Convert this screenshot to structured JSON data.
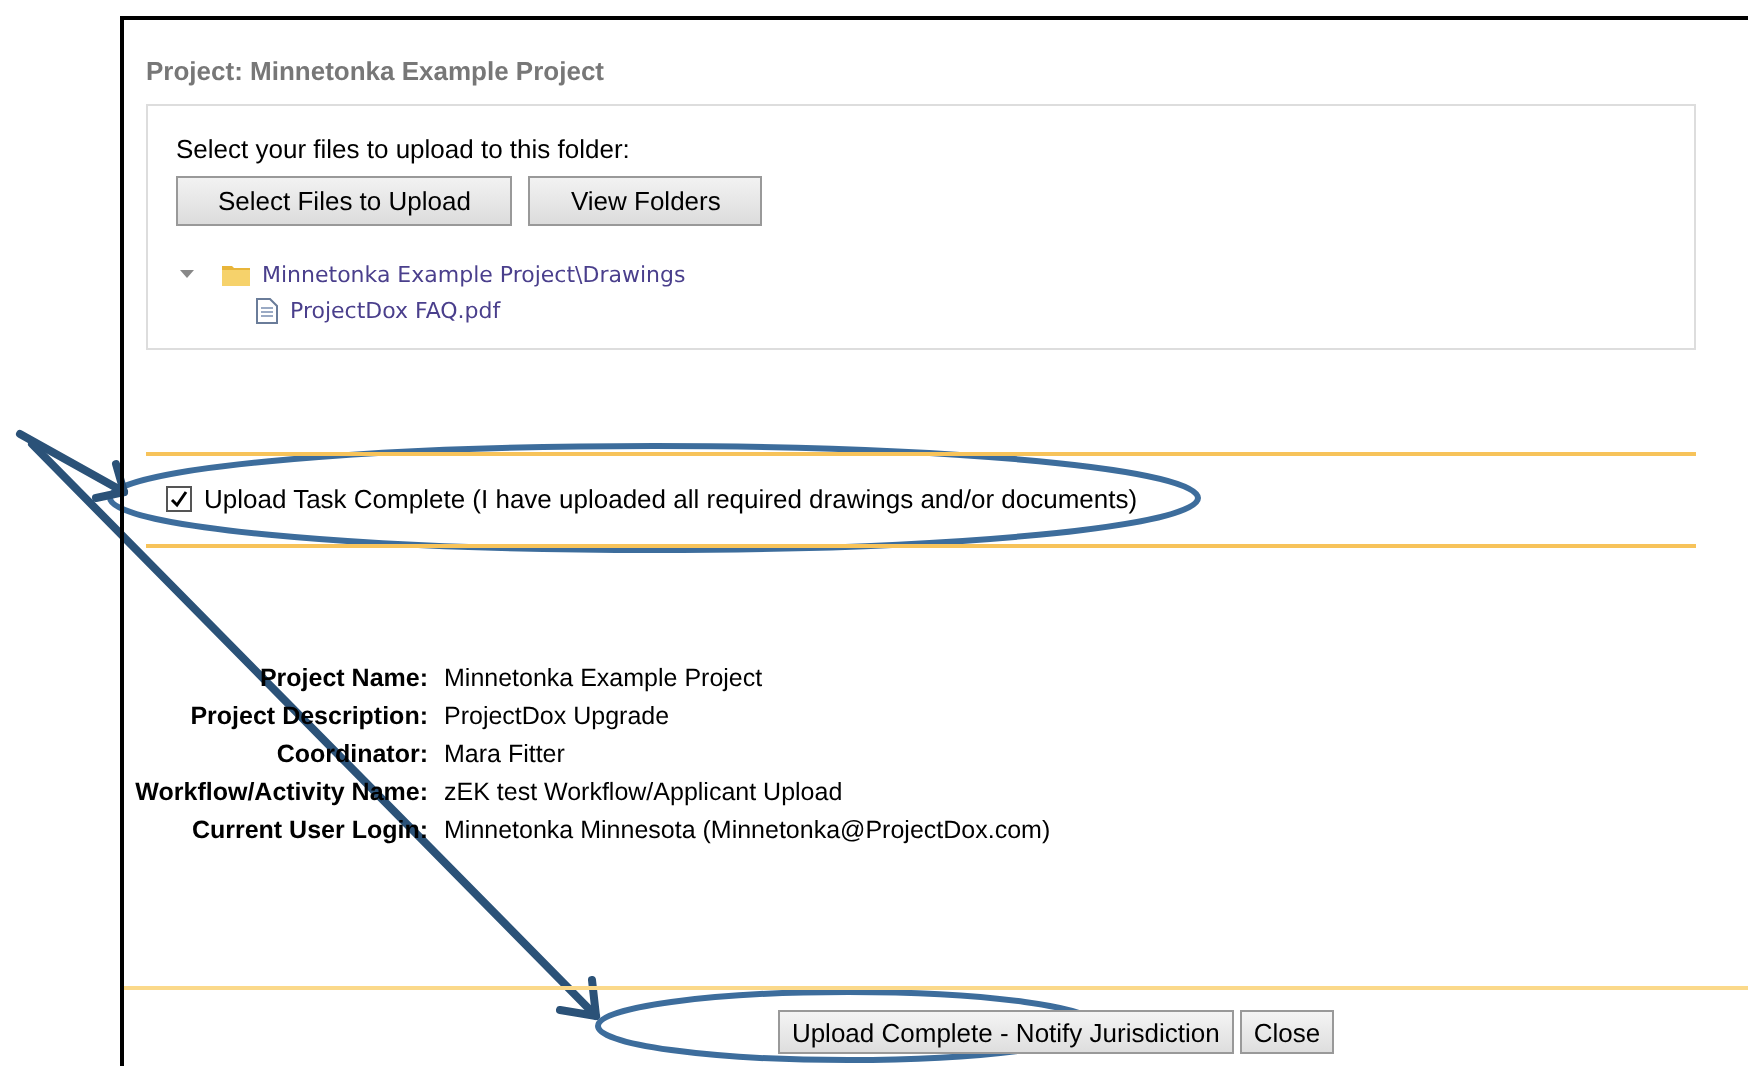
{
  "title": "Project: Minnetonka Example Project",
  "upload": {
    "prompt": "Select your files to upload to this folder:",
    "buttons": [
      "Select Files to Upload",
      "View Folders"
    ],
    "tree": [
      {
        "label": "Minnetonka Example Project\\Drawings",
        "expanded": true,
        "children": [
          {
            "label": "ProjectDox FAQ.pdf"
          }
        ]
      }
    ]
  },
  "task_complete": {
    "label": "Upload Task Complete (I have uploaded all required drawings and/or documents)",
    "checked": true
  },
  "details": [
    {
      "label": "Project Name:",
      "value": "Minnetonka Example Project"
    },
    {
      "label": "Project Description:",
      "value": "ProjectDox Upgrade"
    },
    {
      "label": "Coordinator:",
      "value": "Mara Fitter"
    },
    {
      "label": "Workflow/Activity Name:",
      "value": "zEK test Workflow/Applicant Upload"
    },
    {
      "label": "Current User Login:",
      "value": "Minnetonka Minnesota (Minnetonka@ProjectDox.com)"
    }
  ],
  "actions": [
    "Upload Complete - Notify Jurisdiction",
    "Close"
  ]
}
